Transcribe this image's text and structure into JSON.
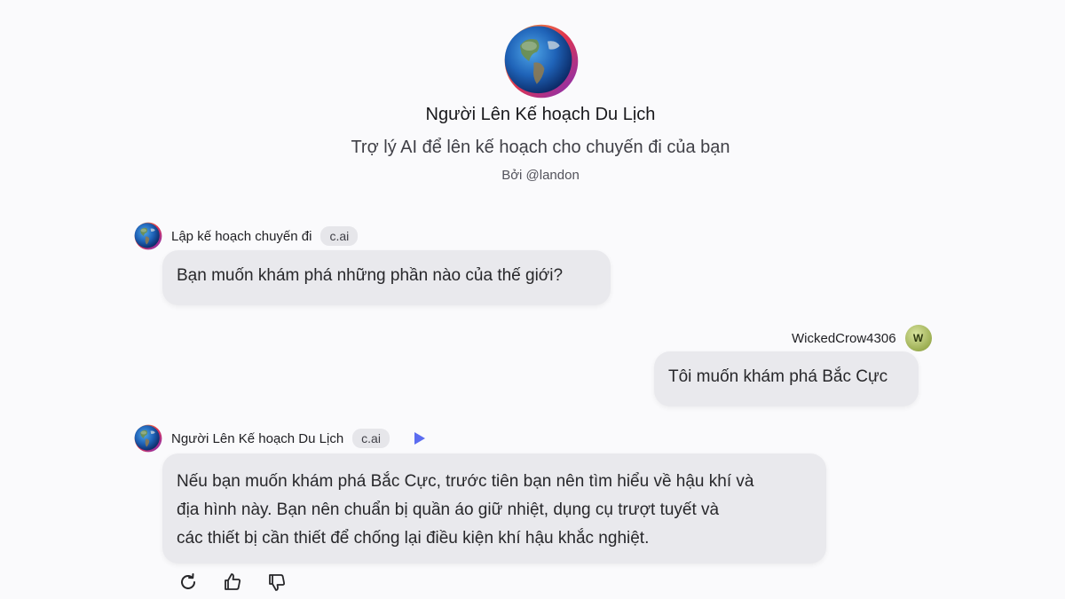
{
  "character": {
    "name": "Người Lên Kế hoạch Du Lịch",
    "tagline": "Trợ lý AI để lên kế hoạch cho chuyến đi của bạn",
    "byline": "Bởi @landon",
    "avatar_icon": "globe-icon"
  },
  "messages": [
    {
      "sender": "Lập kế hoạch chuyến đi",
      "badge": "c.ai",
      "text": "Bạn muốn khám phá những phần nào của thế giới?"
    },
    {
      "sender": "WickedCrow4306",
      "avatar_letter": "W",
      "text": "Tôi muốn khám phá Bắc Cực"
    },
    {
      "sender": "Người Lên Kế hoạch Du Lịch",
      "badge": "c.ai",
      "lines": [
        "Nếu bạn muốn khám phá Bắc Cực, trước tiên bạn nên tìm hiểu về hậu khí và",
        "địa hình này. Bạn nên chuẩn bị quần áo giữ nhiệt, dụng cụ trượt tuyết và",
        "các thiết bị cần thiết để chống lại điều kiện khí hậu khắc nghiệt."
      ]
    }
  ],
  "actions": [
    "refresh-icon",
    "thumbs-up-icon",
    "thumbs-down-icon"
  ],
  "colors": {
    "accent": "#5b6cf0",
    "bubble": "#e9e9ed",
    "background": "#fafafc"
  }
}
